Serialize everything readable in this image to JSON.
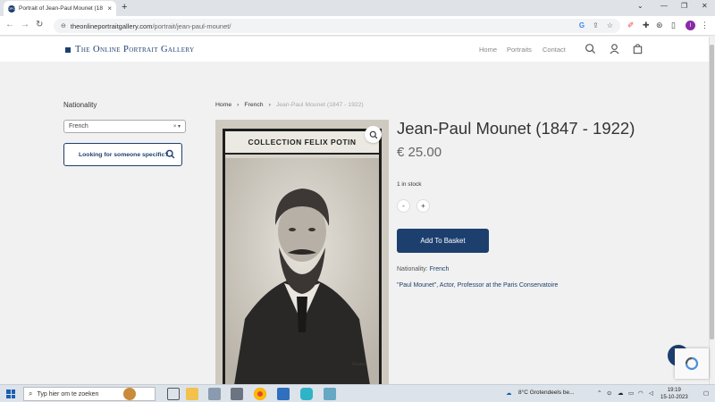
{
  "browser": {
    "tab_title": "Portrait of Jean-Paul Mounet (18",
    "tab_close": "×",
    "new_tab": "+",
    "url_domain": "theonlineportraitgallery.com",
    "url_path": "/portrait/jean-paul-mounet/",
    "profile_initial": "I"
  },
  "site": {
    "logo_text": "The Online Portrait Gallery",
    "nav": [
      "Home",
      "Portraits",
      "Contact"
    ],
    "brand_color": "#1d3f6e"
  },
  "sidebar": {
    "filter_title": "Nationality",
    "select_value": "French",
    "search_label": "Looking for someone specific?"
  },
  "breadcrumb": {
    "home": "Home",
    "sep": "›",
    "category": "French",
    "current": "Jean-Paul Mounet (1847 - 1922)"
  },
  "product": {
    "card_label": "COLLECTION FELIX POTIN",
    "title": "Jean-Paul Mounet (1847 - 1922)",
    "price": "€ 25.00",
    "stock": "1 in stock",
    "minus": "-",
    "plus": "+",
    "add_button": "Add To Basket",
    "meta_label": "Nationality:",
    "meta_value": "French",
    "description": "\"Paul Mounet\", Actor, Professor at the Paris Conservatoire"
  },
  "taskbar": {
    "search_placeholder": "Typ hier om te zoeken",
    "weather": "8°C  Grotendeels be...",
    "time": "19:19",
    "date": "15-10-2023"
  }
}
